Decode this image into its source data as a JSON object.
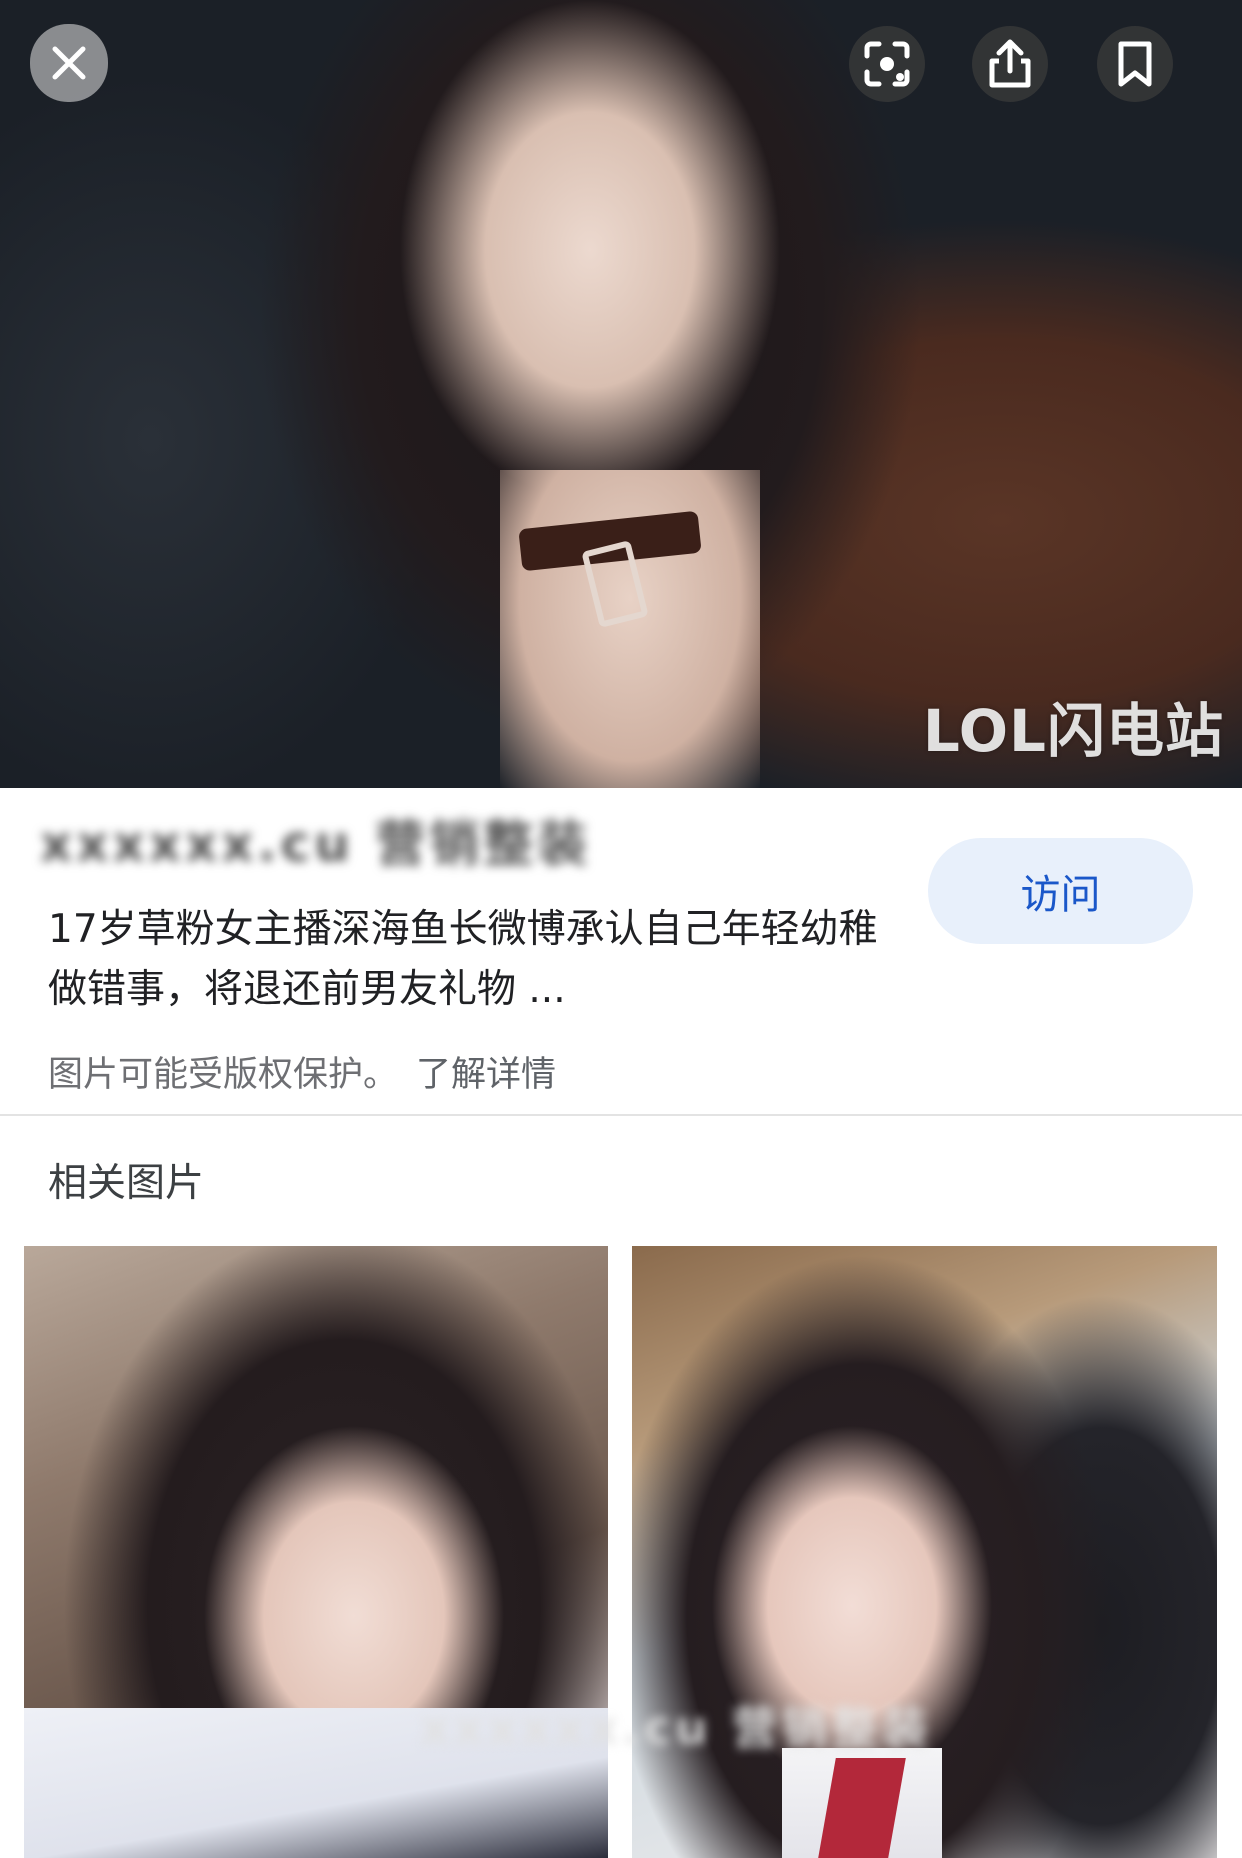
{
  "hero": {
    "watermark": "LOL闪电站",
    "buttons": {
      "close_icon": "close-icon",
      "lens_icon": "lens-icon",
      "share_icon": "share-icon",
      "save_icon": "bookmark-icon"
    }
  },
  "result": {
    "source_name": "xxxxxx.cu 营销整装",
    "title": "17岁草粉女主播深海鱼长微博承认自己年轻幼稚做错事，将退还前男友礼物 ...",
    "visit_label": "访问",
    "copyright_notice": "图片可能受版权保护。",
    "learn_more_label": "了解详情"
  },
  "related": {
    "heading": "相关图片",
    "watermark": "xxxxxx.cu 营销整装"
  },
  "colors": {
    "visit_bg": "#e8f0fb",
    "visit_text": "#1a57c9",
    "divider": "#e3e3e3"
  }
}
